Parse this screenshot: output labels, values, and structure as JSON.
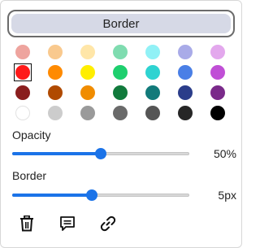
{
  "header": {
    "tab_label": "Border"
  },
  "palette": {
    "selected_index": 7,
    "rows": [
      [
        "#eea49e",
        "#f9c98e",
        "#ffe6a8",
        "#7fdcb0",
        "#91f1f6",
        "#a9abe8",
        "#e3a8ed"
      ],
      [
        "#ff1a1a",
        "#ff8a00",
        "#ffee00",
        "#1ecf6e",
        "#2ed3d1",
        "#4a7fe6",
        "#c04fd6"
      ],
      [
        "#8a1e1e",
        "#b04a00",
        "#f08c00",
        "#117a3c",
        "#127a7a",
        "#2b3d8a",
        "#7a2a8a"
      ],
      [
        "#ffffff",
        "#cccccc",
        "#9a9a9a",
        "#6a6a6a",
        "#555555",
        "#262626",
        "#000000"
      ]
    ]
  },
  "opacity": {
    "label": "Opacity",
    "value_text": "50%",
    "fraction": 0.5
  },
  "border": {
    "label": "Border",
    "value_text": "5px",
    "fraction": 0.45
  },
  "actions": {
    "delete_icon": "trash-icon",
    "comment_icon": "comment-icon",
    "link_icon": "link-icon"
  }
}
